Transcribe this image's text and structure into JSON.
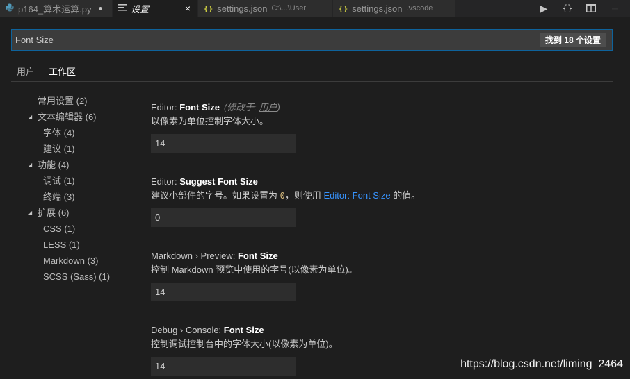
{
  "tabs": [
    {
      "title": "p164_算术运算.py",
      "icon": "python-icon",
      "dirty": "●"
    },
    {
      "title": "设置",
      "icon": "settings-file-icon",
      "close": "×"
    },
    {
      "title": "settings.json",
      "desc": "C:\\...\\User",
      "icon": "braces-icon",
      "braces": "{}"
    },
    {
      "title": "settings.json",
      "desc": ".vscode",
      "icon": "braces-icon",
      "braces": "{}"
    }
  ],
  "actions": {
    "run": "▶",
    "json": "{}",
    "split": "split-editor-icon",
    "more": "···"
  },
  "search": {
    "value": "Font Size",
    "count": "找到 18 个设置"
  },
  "scopes": [
    "用户",
    "工作区"
  ],
  "toc": [
    {
      "label": "常用设置 (2)",
      "level": 0,
      "caret": ""
    },
    {
      "label": "文本编辑器 (6)",
      "level": 0,
      "caret": "◢"
    },
    {
      "label": "字体 (4)",
      "level": 1,
      "caret": ""
    },
    {
      "label": "建议 (1)",
      "level": 1,
      "caret": ""
    },
    {
      "label": "功能 (4)",
      "level": 0,
      "caret": "◢"
    },
    {
      "label": "调试 (1)",
      "level": 1,
      "caret": ""
    },
    {
      "label": "终端 (3)",
      "level": 1,
      "caret": ""
    },
    {
      "label": "扩展 (6)",
      "level": 0,
      "caret": "◢"
    },
    {
      "label": "CSS (1)",
      "level": 1,
      "caret": ""
    },
    {
      "label": "LESS (1)",
      "level": 1,
      "caret": ""
    },
    {
      "label": "Markdown (3)",
      "level": 1,
      "caret": ""
    },
    {
      "label": "SCSS (Sass) (1)",
      "level": 1,
      "caret": ""
    }
  ],
  "settings": [
    {
      "category": "Editor: ",
      "key": "Font Size",
      "modified_prefix": "(修改于: ",
      "modified_scope": "用户",
      "modified_suffix": ")",
      "description": "以像素为单位控制字体大小。",
      "value": "14"
    },
    {
      "category": "Editor: ",
      "key": "Suggest Font Size",
      "desc_before": "建议小部件的字号。如果设置为 ",
      "desc_code": "0",
      "desc_mid": "，则使用 ",
      "desc_link": "Editor: Font Size",
      "desc_after": " 的值。",
      "value": "0"
    },
    {
      "category": "Markdown › Preview: ",
      "key": "Font Size",
      "description": "控制 Markdown 预览中使用的字号(以像素为单位)。",
      "value": "14"
    },
    {
      "category": "Debug › Console: ",
      "key": "Font Size",
      "description": "控制调试控制台中的字体大小(以像素为单位)。",
      "value": "14"
    }
  ],
  "watermark": "https://blog.csdn.net/liming_2464",
  "colors": {
    "accent": "#0e639c",
    "link": "#3794ff",
    "background": "#1e1e1e"
  }
}
